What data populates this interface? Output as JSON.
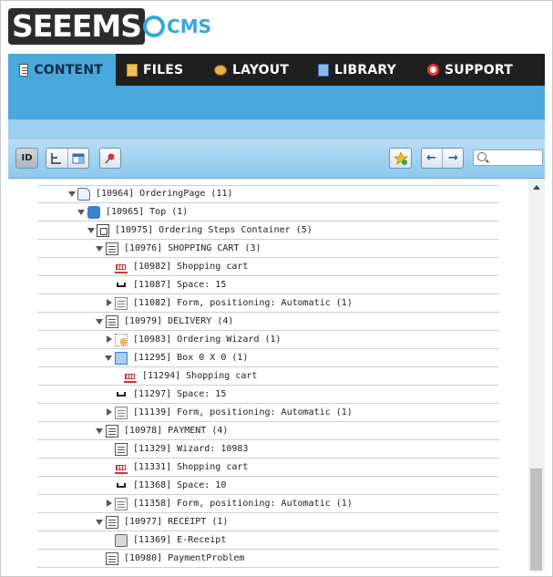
{
  "logo": {
    "main": "SEEEMS",
    "suffix": "CMS"
  },
  "nav": {
    "tabs": [
      {
        "label": "CONTENT",
        "icon": "document-icon",
        "active": true
      },
      {
        "label": "FILES",
        "icon": "files-icon",
        "active": false
      },
      {
        "label": "LAYOUT",
        "icon": "palette-icon",
        "active": false
      },
      {
        "label": "LIBRARY",
        "icon": "book-icon",
        "active": false
      },
      {
        "label": "SUPPORT",
        "icon": "lifebuoy-icon",
        "active": false
      }
    ]
  },
  "toolbar": {
    "id_label": "ID",
    "search_placeholder": ""
  },
  "tree": {
    "rows": [
      {
        "label": "[10964] OrderingPage (11)",
        "icon": "page-icon",
        "toggle": "open"
      },
      {
        "label": "[10965] Top (1)",
        "icon": "puzzle-icon",
        "toggle": "open"
      },
      {
        "label": "[10975] Ordering Steps Container (5)",
        "icon": "container-icon",
        "toggle": "open"
      },
      {
        "label": "[10976] SHOPPING CART (3)",
        "icon": "list-icon",
        "toggle": "open"
      },
      {
        "label": "[10982] Shopping cart",
        "icon": "cart-icon",
        "toggle": "none"
      },
      {
        "label": "[11087] Space: 15",
        "icon": "space-icon",
        "toggle": "none"
      },
      {
        "label": "[11082] Form, positioning: Automatic (1)",
        "icon": "form-icon",
        "toggle": "closed"
      },
      {
        "label": "[10979] DELIVERY (4)",
        "icon": "list-icon",
        "toggle": "open"
      },
      {
        "label": "[10983] Ordering Wizard (1)",
        "icon": "wizard-icon",
        "toggle": "closed"
      },
      {
        "label": "[11295] Box 0 X 0 (1)",
        "icon": "box-icon",
        "toggle": "open"
      },
      {
        "label": "[11294] Shopping cart",
        "icon": "cart-icon",
        "toggle": "none"
      },
      {
        "label": "[11297] Space: 15",
        "icon": "space-icon",
        "toggle": "none"
      },
      {
        "label": "[11139] Form, positioning: Automatic (1)",
        "icon": "form-icon",
        "toggle": "closed"
      },
      {
        "label": "[10978] PAYMENT (4)",
        "icon": "list-icon",
        "toggle": "open"
      },
      {
        "label": "[11329] Wizard: 10983",
        "icon": "list-icon",
        "toggle": "none"
      },
      {
        "label": "[11331] Shopping cart",
        "icon": "cart-icon",
        "toggle": "none"
      },
      {
        "label": "[11368] Space: 10",
        "icon": "space-icon",
        "toggle": "none"
      },
      {
        "label": "[11358] Form, positioning: Automatic (1)",
        "icon": "form-icon",
        "toggle": "closed"
      },
      {
        "label": "[10977] RECEIPT (1)",
        "icon": "list-icon",
        "toggle": "open"
      },
      {
        "label": "[11369] E-Receipt",
        "icon": "receipt-icon",
        "toggle": "none"
      },
      {
        "label": "[10980] PaymentProblem",
        "icon": "list-icon",
        "toggle": "none"
      }
    ]
  },
  "colors": {
    "nav_bg": "#1f1f1f",
    "active_tab": "#49a9dc",
    "bar_blue": "#49a9dc",
    "bar_light": "#9cd0ee"
  }
}
